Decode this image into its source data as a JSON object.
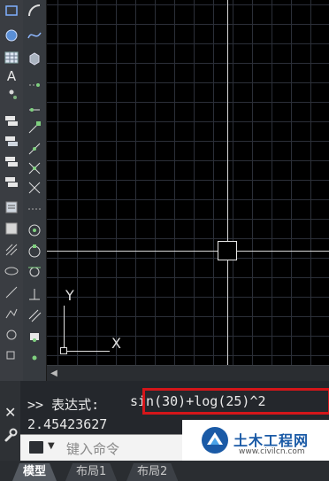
{
  "left_toolbar": {
    "text_tool": "A",
    "tools": [
      "rectangle-icon",
      "arc-icon",
      "circle-icon",
      "spline-icon",
      "region-icon",
      "hatch-icon",
      "table-icon",
      "box-3d-icon",
      "text-icon",
      "point-icon",
      "multileader-icon",
      "leader-icon",
      "layer-stack-icon",
      "blocks-icon",
      "insert-block-icon",
      "attribute-icon"
    ]
  },
  "snap_toolbar": {
    "tools": [
      "snap-temp-track-icon",
      "snap-from-icon",
      "snap-endpoint-icon",
      "snap-midpoint-icon",
      "snap-intersection-icon",
      "snap-apparent-intersection-icon",
      "snap-extension-icon",
      "snap-center-icon",
      "snap-quadrant-icon",
      "snap-tangent-icon",
      "snap-perpendicular-icon",
      "snap-parallel-icon",
      "snap-insert-icon",
      "snap-node-icon",
      "snap-nearest-icon"
    ]
  },
  "ucs": {
    "y_label": "Y",
    "x_label": "X"
  },
  "command": {
    "history_prompt": ">> 表达式:",
    "history_expression": "sin(30)+log(25)^2",
    "result": "2.45423627",
    "input_placeholder": "键入命令",
    "close_glyph": "✕"
  },
  "tabs": [
    {
      "label": "模型",
      "active": true
    },
    {
      "label": "布局1",
      "active": false
    },
    {
      "label": "布局2",
      "active": false
    }
  ],
  "watermark": {
    "title": "土木工程网",
    "url": "www.civilcn.com"
  },
  "colors": {
    "highlight": "#d4161a",
    "canvas": "#000000",
    "grid": "#2b2f38"
  }
}
